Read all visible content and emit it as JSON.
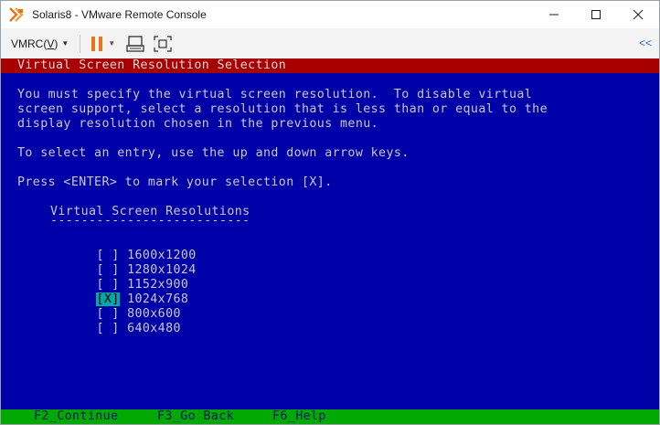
{
  "window": {
    "title": "Solaris8 - VMware Remote Console",
    "icon": "vmware-icon",
    "controls": [
      "minimize-icon",
      "maximize-icon",
      "close-icon"
    ]
  },
  "toolbar": {
    "vmrc_label": "VMRC(V)",
    "vmrc_mnemonic_prefix": "VMRC(",
    "vmrc_mnemonic_key": "V",
    "vmrc_mnemonic_suffix": ")",
    "pause_icon": "pause-icon",
    "send_keys_icon": "send-ctrl-alt-del-icon",
    "fullscreen_icon": "fullscreen-icon",
    "collapse_label": "<<",
    "accent_color": "#e8741a"
  },
  "console": {
    "header": "Virtual Screen Resolution Selection",
    "paragraph1": [
      "You must specify the virtual screen resolution.  To disable virtual",
      "screen support, select a resolution that is less than or equal to the",
      "display resolution chosen in the previous menu."
    ],
    "instruction1": "To select an entry, use the up and down arrow keys.",
    "instruction2": "Press <ENTER> to mark your selection [X].",
    "list_title": "Virtual Screen Resolutions",
    "list_underline": "--------------------------",
    "resolutions": [
      {
        "box": "[ ]",
        "label": "1600x1200",
        "selected": false
      },
      {
        "box": "[ ]",
        "label": "1280x1024",
        "selected": false
      },
      {
        "box": "[ ]",
        "label": "1152x900",
        "selected": false
      },
      {
        "box": "[X]",
        "label": "1024x768",
        "selected": true
      },
      {
        "box": "[ ]",
        "label": "800x600",
        "selected": false
      },
      {
        "box": "[ ]",
        "label": "640x480",
        "selected": false
      }
    ],
    "footer": {
      "continue": "F2_Continue",
      "go_back": "F3_Go Back",
      "help": "F6_Help"
    },
    "colors": {
      "background": "#0000a8",
      "header": "#a80000",
      "footer": "#00a800",
      "selection": "#00a8a8",
      "text": "#c8c8c8"
    }
  }
}
